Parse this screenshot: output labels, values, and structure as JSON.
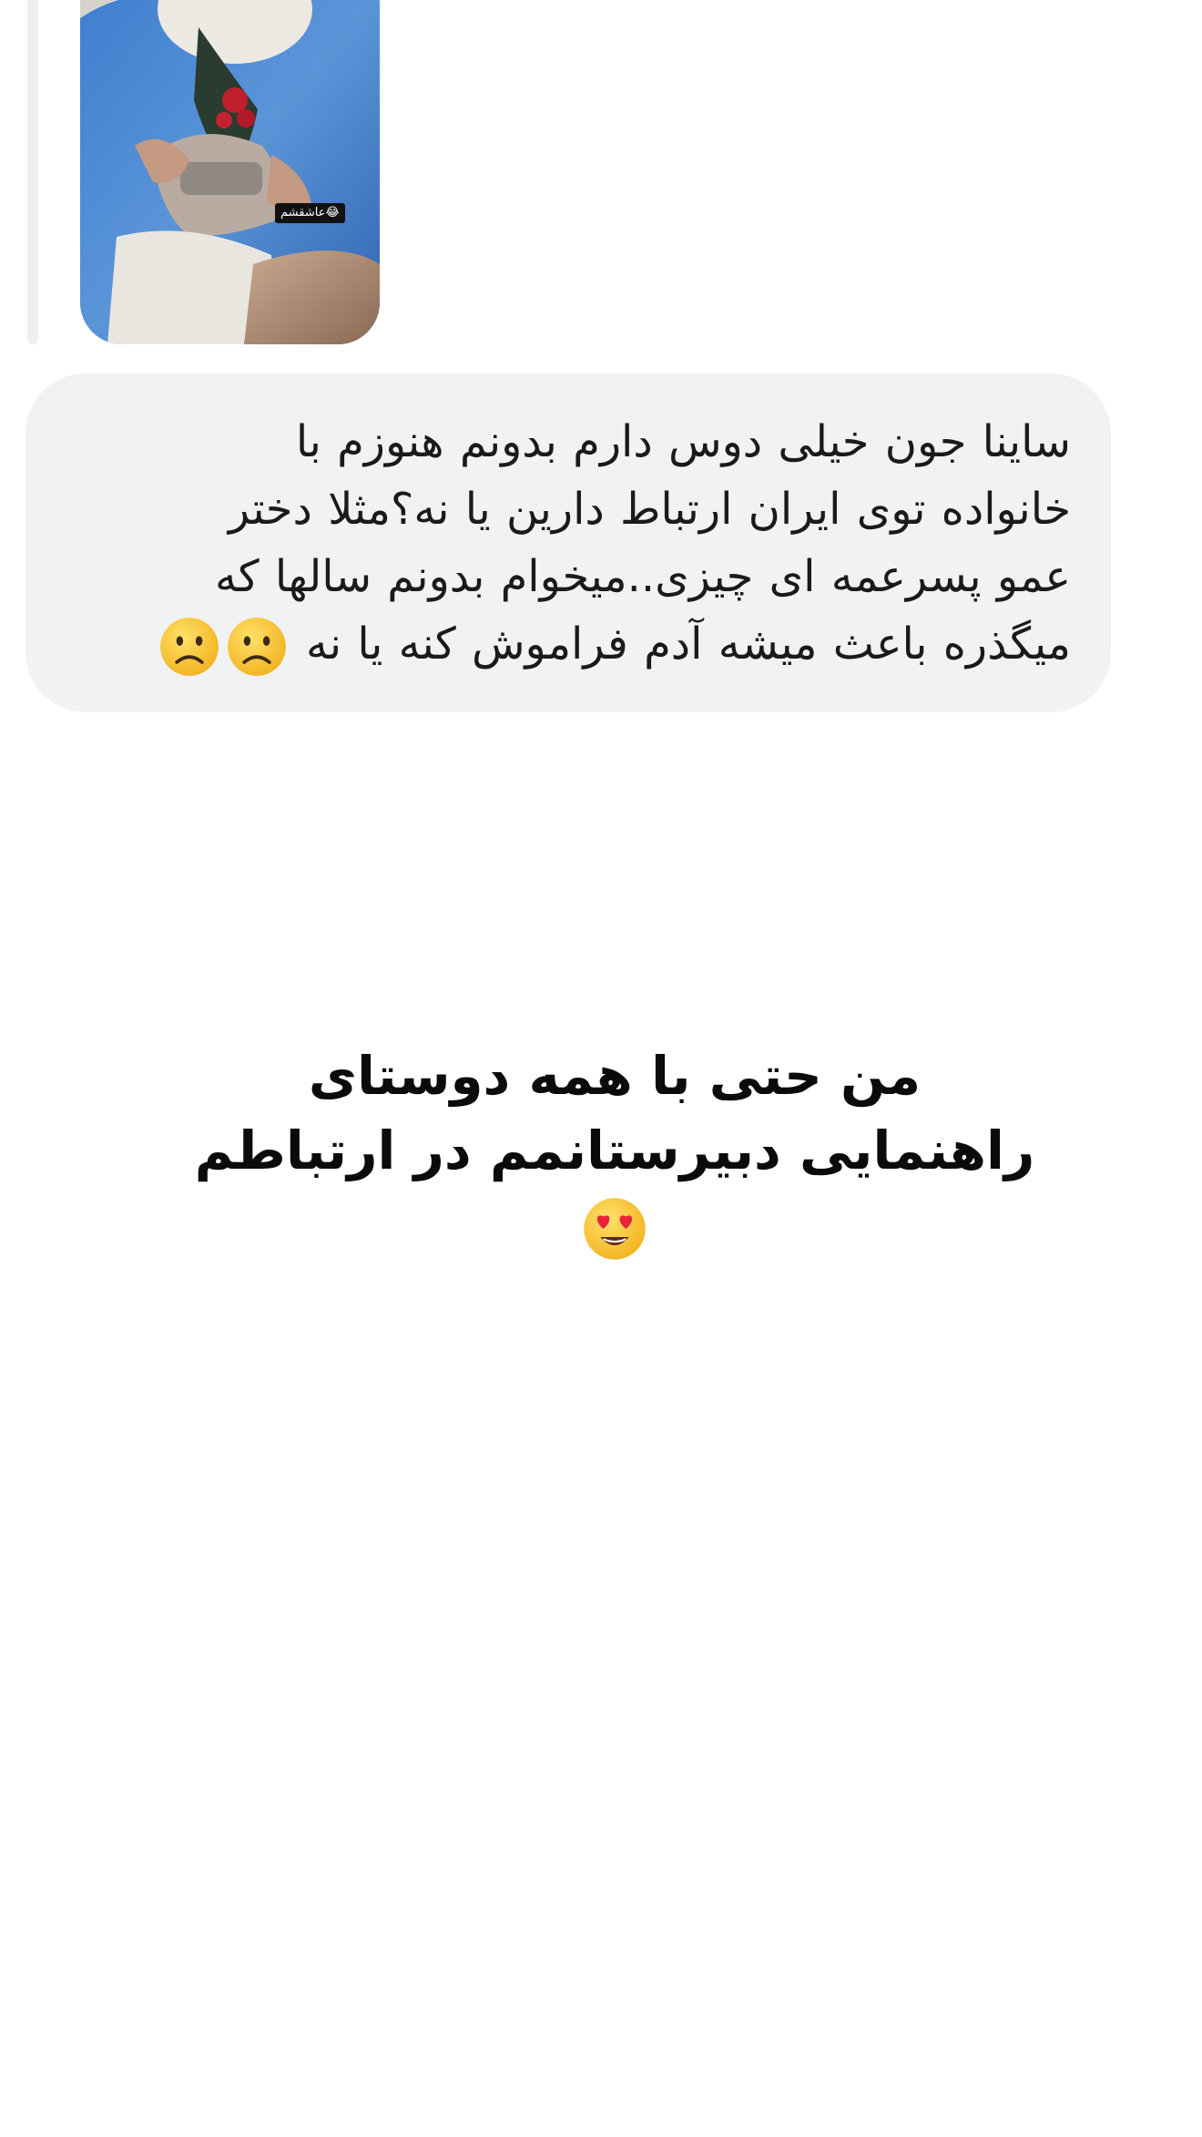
{
  "reply_preview": {
    "photo_sticker_text": "عاشقشم😂"
  },
  "message": {
    "lines": [
      "ساینا جون خیلی دوس دارم بدونم هنوزم با",
      "خانواده توی ایران ارتباط دارین یا نه؟مثلا دختر",
      "عمو پسرعمه ای چیزی..میخوام بدونم سالها که",
      "میگذره باعث میشه آدم فراموش کنه یا نه"
    ],
    "trailing_emojis": [
      "frowning-face-icon",
      "frowning-face-icon"
    ]
  },
  "caption": {
    "line1": "من حتی با همه دوستای",
    "line2": "راهنمایی دبیرستانمم در ارتباطم",
    "emoji": "heart-eyes-face-icon"
  },
  "colors": {
    "bubble_bg": "#f1f2f4",
    "text": "#1a1a1a",
    "emoji_yellow": "#f7c02a"
  }
}
